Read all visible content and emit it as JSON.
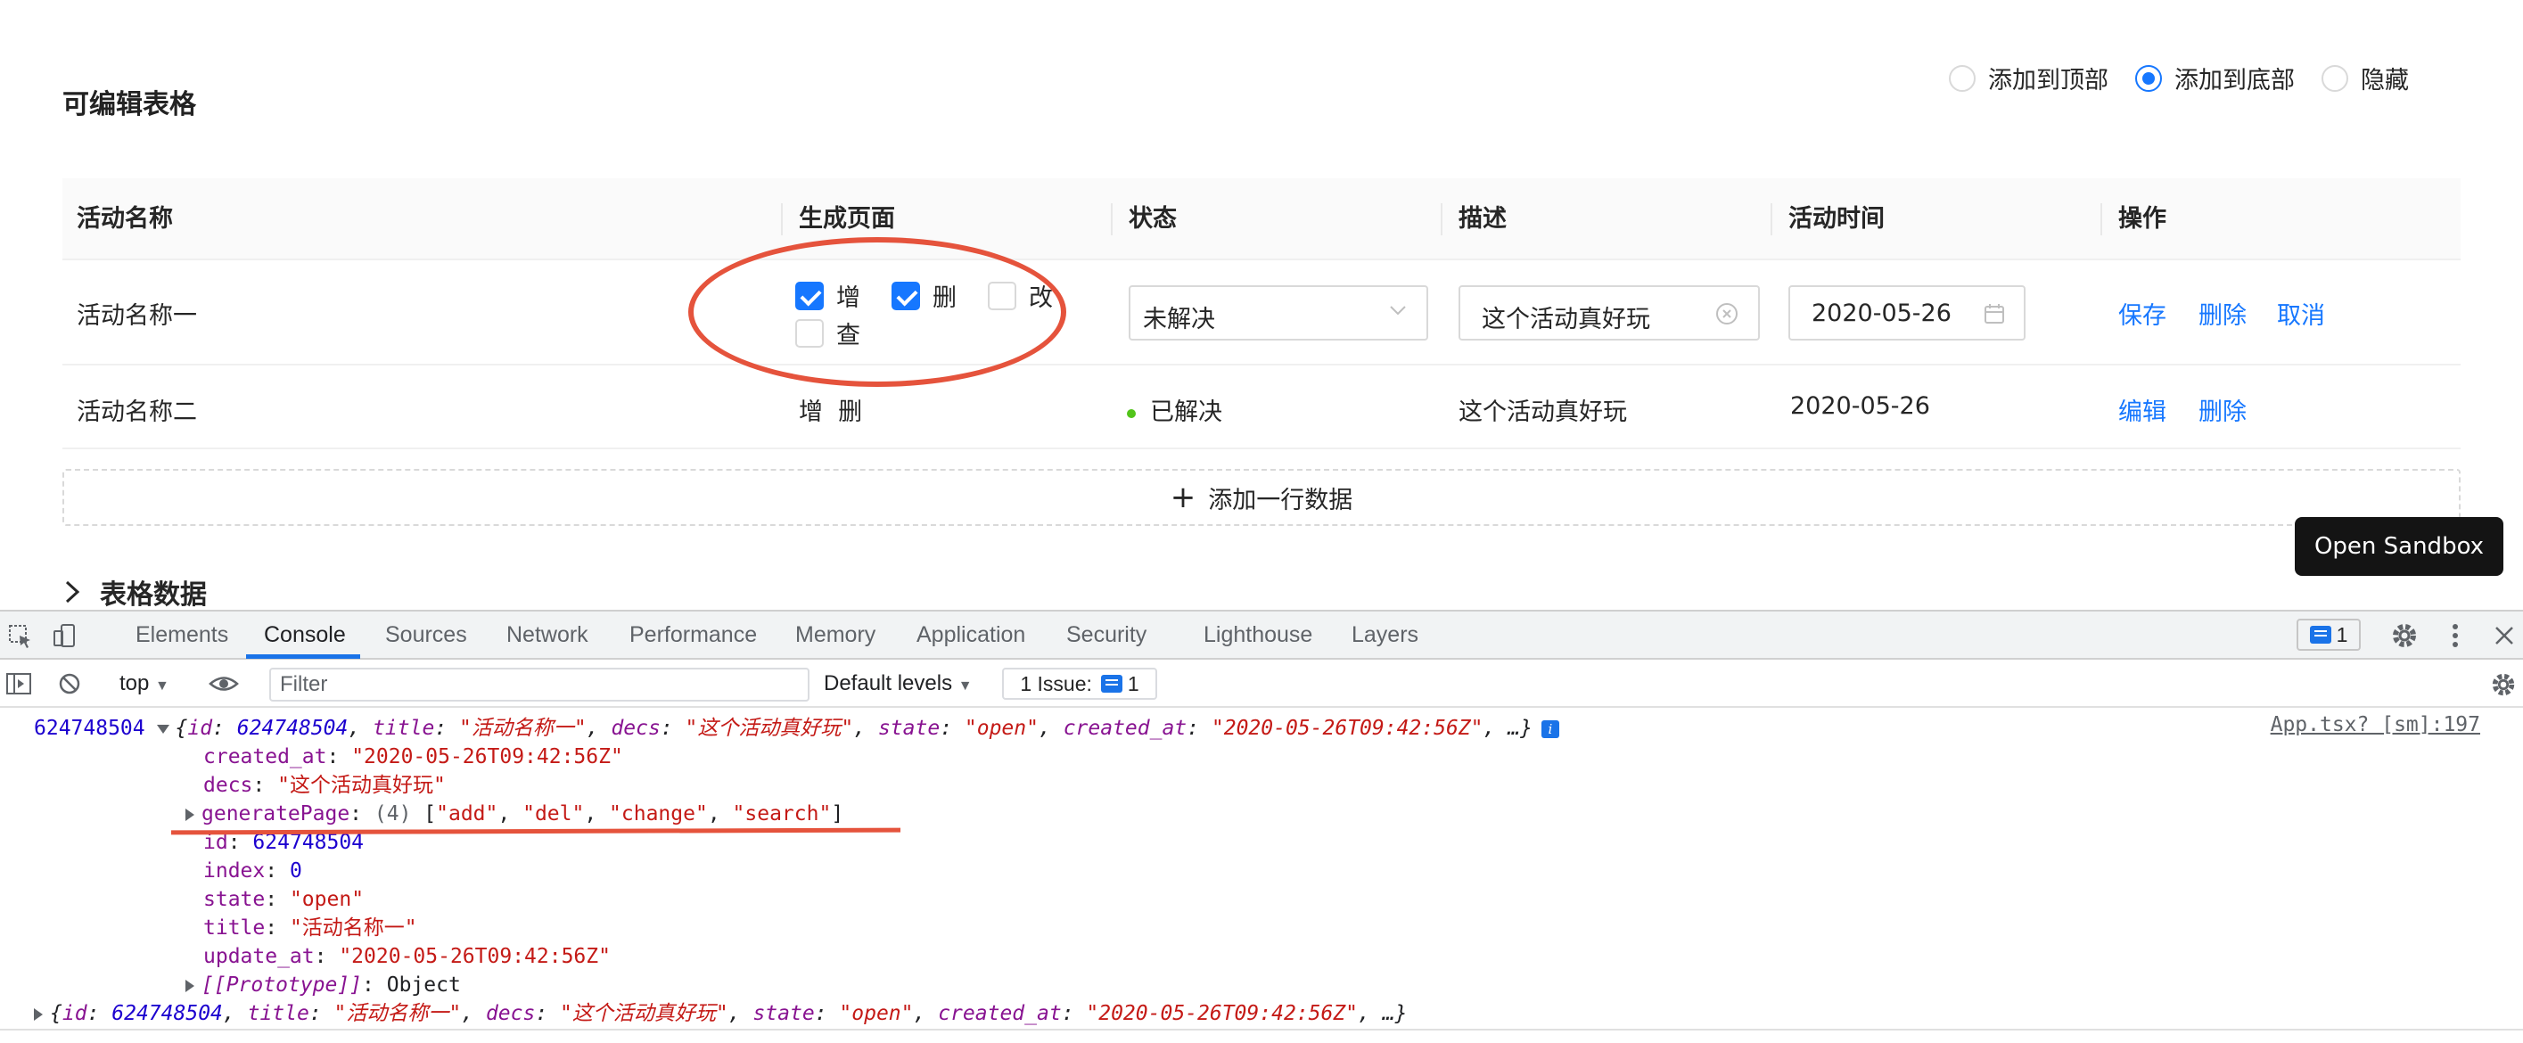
{
  "page": {
    "title": "可编辑表格",
    "radio_options": [
      {
        "label": "添加到顶部",
        "checked": false
      },
      {
        "label": "添加到底部",
        "checked": true
      },
      {
        "label": "隐藏",
        "checked": false
      }
    ],
    "columns": [
      "活动名称",
      "生成页面",
      "状态",
      "描述",
      "活动时间",
      "操作"
    ],
    "row1": {
      "name": "活动名称一",
      "checkboxes": [
        {
          "label": "增",
          "checked": true
        },
        {
          "label": "删",
          "checked": true
        },
        {
          "label": "改",
          "checked": false
        },
        {
          "label": "查",
          "checked": false
        }
      ],
      "state": "未解决",
      "desc": "这个活动真好玩",
      "date": "2020-05-26",
      "actions": [
        "保存",
        "删除",
        "取消"
      ]
    },
    "row2": {
      "name": "活动名称二",
      "pages": "增  删",
      "state": "已解决",
      "desc": "这个活动真好玩",
      "date": "2020-05-26",
      "actions": [
        "编辑",
        "删除"
      ]
    },
    "add_row_label": "添加一行数据",
    "collapse_label": "表格数据",
    "sandbox_button": "Open Sandbox"
  },
  "devtools": {
    "tabs": [
      "Elements",
      "Console",
      "Sources",
      "Network",
      "Performance",
      "Memory",
      "Application",
      "Security",
      "Lighthouse",
      "Layers"
    ],
    "active_tab": "Console",
    "messages_badge": "1",
    "context": "top",
    "filter_placeholder": "Filter",
    "levels": "Default levels",
    "issues_label": "1 Issue:",
    "issues_count": "1",
    "log_prefix": "624748504",
    "source": "App.tsx? [sm]:197",
    "obj_summary": {
      "id": "624748504",
      "title": "\"活动名称一\"",
      "decs": "\"这个活动真好玩\"",
      "state": "\"open\"",
      "created_at": "\"2020-05-26T09:42:56Z\"",
      "more": "…}"
    },
    "props": {
      "created_at": "\"2020-05-26T09:42:56Z\"",
      "decs": "\"这个活动真好玩\"",
      "generatePage_len": "(4)",
      "generatePage_items": [
        "\"add\"",
        "\"del\"",
        "\"change\"",
        "\"search\""
      ],
      "id": "624748504",
      "index": "0",
      "state": "\"open\"",
      "title": "\"活动名称一\"",
      "update_at": "\"2020-05-26T09:42:56Z\"",
      "prototype": "Object"
    }
  }
}
